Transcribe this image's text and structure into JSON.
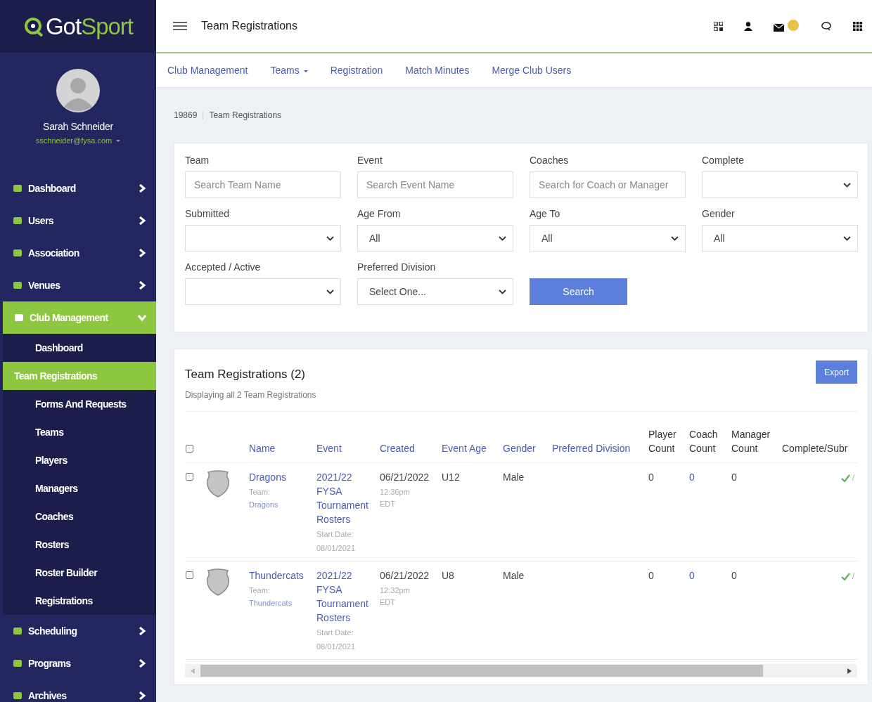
{
  "brand": {
    "left": "Got",
    "right": "Sport"
  },
  "user": {
    "name": "Sarah Schneider",
    "email": "sschneider@fysa.com"
  },
  "sidebar": [
    {
      "label": "Dashboard",
      "expanded": false
    },
    {
      "label": "Users",
      "expanded": false
    },
    {
      "label": "Association",
      "expanded": false
    },
    {
      "label": "Venues",
      "expanded": false
    },
    {
      "label": "Club Management",
      "expanded": true,
      "children": [
        {
          "label": "Dashboard",
          "selected": false
        },
        {
          "label": "Team Registrations",
          "selected": true
        },
        {
          "label": "Forms And Requests",
          "selected": false
        },
        {
          "label": "Teams",
          "selected": false
        },
        {
          "label": "Players",
          "selected": false
        },
        {
          "label": "Managers",
          "selected": false
        },
        {
          "label": "Coaches",
          "selected": false
        },
        {
          "label": "Rosters",
          "selected": false
        },
        {
          "label": "Roster Builder",
          "selected": false
        },
        {
          "label": "Registrations",
          "selected": false
        }
      ]
    },
    {
      "label": "Scheduling",
      "expanded": false
    },
    {
      "label": "Programs",
      "expanded": false
    },
    {
      "label": "Archives",
      "expanded": false
    }
  ],
  "header": {
    "title": "Team Registrations"
  },
  "subnav": [
    {
      "label": "Club Management",
      "dropdown": false
    },
    {
      "label": "Teams",
      "dropdown": true
    },
    {
      "label": "Registration",
      "dropdown": false
    },
    {
      "label": "Match Minutes",
      "dropdown": false
    },
    {
      "label": "Merge Club Users",
      "dropdown": false
    }
  ],
  "breadcrumb": [
    "19869",
    "Team Registrations"
  ],
  "filters": [
    {
      "kind": "text",
      "label": "Team",
      "placeholder": "Search Team Name"
    },
    {
      "kind": "text",
      "label": "Event",
      "placeholder": "Search Event Name"
    },
    {
      "kind": "text",
      "label": "Coaches",
      "placeholder": "Search for Coach or Manager"
    },
    {
      "kind": "select",
      "label": "Complete"
    },
    {
      "kind": "select",
      "label": "Submitted"
    },
    {
      "kind": "select",
      "label": "Age From",
      "value": "All"
    },
    {
      "kind": "select",
      "label": "Age To",
      "value": "All"
    },
    {
      "kind": "select",
      "label": "Gender",
      "value": "All"
    },
    {
      "kind": "select",
      "label": "Accepted / Active"
    },
    {
      "kind": "select",
      "label": "Preferred Division",
      "value": "Select One..."
    },
    {
      "kind": "button",
      "label": "Search"
    }
  ],
  "registrations": {
    "title": "Team Registrations (2)",
    "subtitle": "Displaying all 2 Team Registrations",
    "export": "Export",
    "all_checked": false,
    "columns": [
      {
        "label": "Name",
        "sortable": true
      },
      {
        "label": "Event",
        "sortable": true
      },
      {
        "label": "Created",
        "sortable": true
      },
      {
        "label": "Event Age",
        "sortable": true
      },
      {
        "label": "Gender",
        "sortable": true
      },
      {
        "label": "Preferred Division",
        "sortable": true
      },
      {
        "label": "Player Count",
        "sortable": false
      },
      {
        "label": "Coach Count",
        "sortable": false
      },
      {
        "label": "Manager Count",
        "sortable": false
      },
      {
        "label": "Complete/Subr",
        "sortable": false
      }
    ],
    "rows": [
      {
        "checked": false,
        "name": "Dragons",
        "team_label": "Team:",
        "team": "Dragons",
        "event": "2021/22 FYSA Tournament Rosters",
        "start_label": "Start Date:",
        "start_date": "08/01/2021",
        "created": "06/21/2022",
        "created_time": "12:36pm EDT",
        "event_age": "U12",
        "gender": "Male",
        "player_count": "0",
        "coach_count": "0",
        "manager_count": "0",
        "complete": true,
        "complete_separator": "/"
      },
      {
        "checked": false,
        "name": "Thundercats",
        "team_label": "Team:",
        "team": "Thundercats",
        "event": "2021/22 FYSA Tournament Rosters",
        "start_label": "Start Date:",
        "start_date": "08/01/2021",
        "created": "06/21/2022",
        "created_time": "12:32pm EDT",
        "event_age": "U8",
        "gender": "Male",
        "player_count": "0",
        "coach_count": "0",
        "manager_count": "0",
        "complete": true,
        "complete_separator": "/"
      }
    ]
  }
}
